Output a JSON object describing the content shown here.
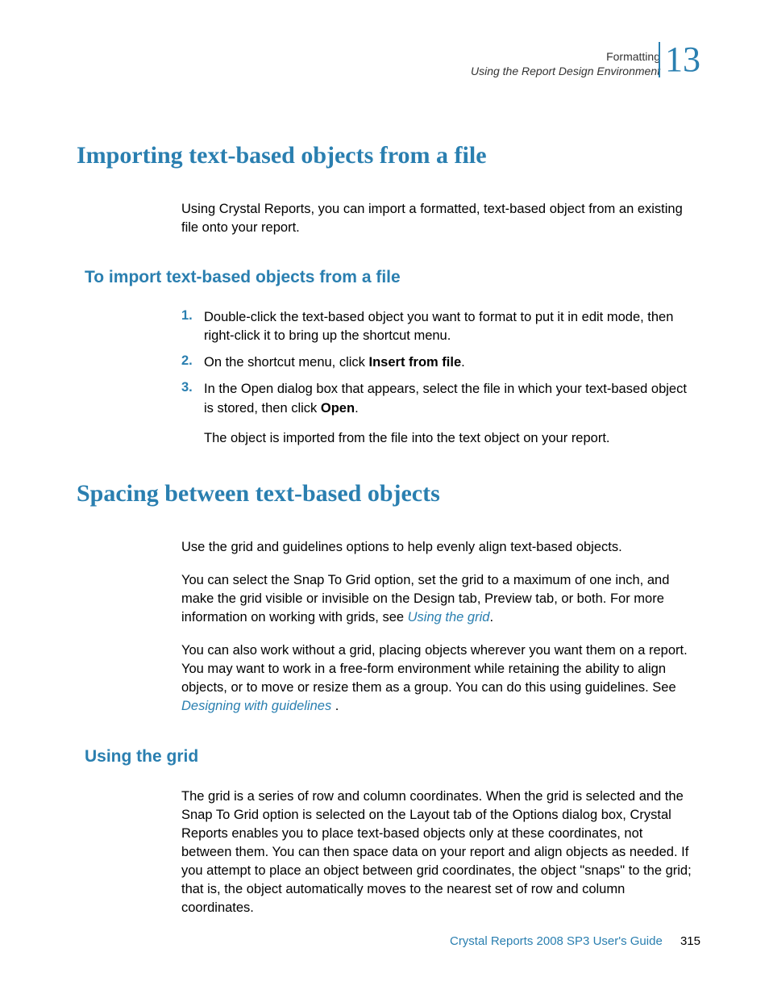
{
  "header": {
    "chapter_label": "Formatting",
    "breadcrumb": "Using the Report Design Environment",
    "chapter_num": "13"
  },
  "section1": {
    "title": "Importing text-based objects from a file",
    "intro": "Using Crystal Reports, you can import a formatted, text-based object from an existing file onto your report.",
    "subhead": "To import text-based objects from a file",
    "steps": [
      {
        "num": "1.",
        "text": "Double-click the text-based object you want to format to put it in edit mode, then right-click it to bring up the shortcut menu."
      },
      {
        "num": "2.",
        "pre": "On the shortcut menu, click ",
        "bold": "Insert from file",
        "post": "."
      },
      {
        "num": "3.",
        "pre": "In the Open dialog box that appears, select the file in which your text-based object is stored, then click ",
        "bold": "Open",
        "post": "."
      }
    ],
    "result": "The object is imported from the file into the text object on your report."
  },
  "section2": {
    "title": "Spacing between text-based objects",
    "p1": "Use the grid and guidelines options to help evenly align text-based objects.",
    "p2_pre": "You can select the Snap To Grid option, set the grid to a maximum of one inch, and make the grid visible or invisible on the Design tab, Preview tab, or both. For more information on working with grids, see ",
    "p2_link": "Using the grid",
    "p2_post": ".",
    "p3_pre": "You can also work without a grid, placing objects wherever you want them on a report. You may want to work in a free-form environment while retaining the ability to align objects, or to move or resize them as a group. You can do this using guidelines. See ",
    "p3_link": "Designing with guidelines",
    "p3_post": " .",
    "subhead": "Using the grid",
    "p4": "The grid is a series of row and column coordinates. When the grid is selected and the Snap To Grid option is selected on the Layout tab of the Options dialog box, Crystal Reports enables you to place text-based objects only at these coordinates, not between them. You can then space data on your report and align objects as needed. If you attempt to place an object between grid coordinates, the object \"snaps\" to the grid; that is, the object automatically moves to the nearest set of row and column coordinates."
  },
  "footer": {
    "title": "Crystal Reports 2008 SP3 User's Guide",
    "page": "315"
  }
}
